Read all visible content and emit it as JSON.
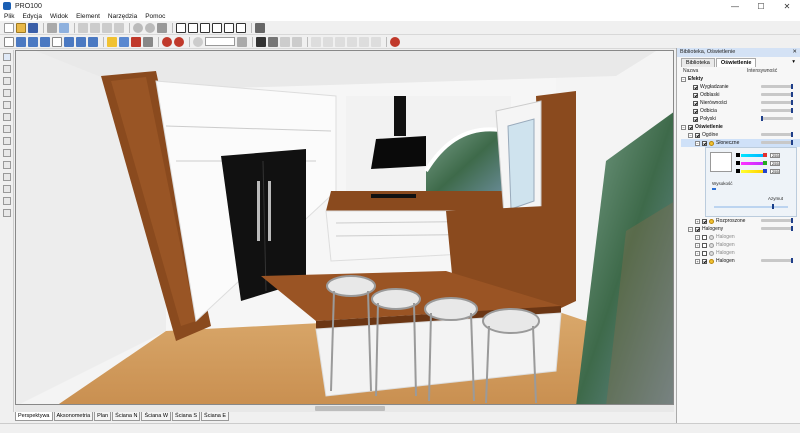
{
  "window": {
    "title": "PRO100",
    "min": "—",
    "max": "☐",
    "close": "✕"
  },
  "menu": [
    "Plik",
    "Edycja",
    "Widok",
    "Element",
    "Narzędzia",
    "Pomoc"
  ],
  "toolbar": {
    "zoom_value": ""
  },
  "view_tabs": [
    "Perspektywa",
    "Aksonometria",
    "Plan",
    "Ściana N",
    "Ściana W",
    "Ściana S",
    "Ściana E"
  ],
  "panel": {
    "title": "Biblioteka, Oświetlenie",
    "close": "✕",
    "tabs": [
      "Biblioteka",
      "Oświetlenie"
    ],
    "dropdown": "▾",
    "col_name": "Nazwa",
    "col_intensity": "Intensywność",
    "effects": {
      "label": "Efekty",
      "items": [
        "Wygładzanie",
        "Odblaski",
        "Nierówności",
        "Odbicia",
        "Połyski"
      ]
    },
    "lighting": {
      "label": "Oświetlenie"
    },
    "general": {
      "label": "Ogólne"
    },
    "sun": {
      "label": "Słoneczne",
      "values": [
        "255",
        "255",
        "255"
      ],
      "height_label": "Wysokość",
      "azimuth_label": "Azymut"
    },
    "diffuse": {
      "label": "Rozproszone"
    },
    "halogens": {
      "label": "Halogeny",
      "items": [
        "Halogen",
        "Halogen",
        "Halogen",
        "Halogen"
      ]
    }
  },
  "colors": {
    "wood": "#8a4a1e",
    "black": "#111111",
    "accent": "#1a5fb4"
  }
}
